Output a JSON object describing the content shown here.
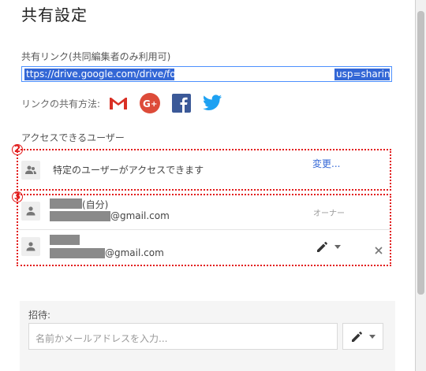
{
  "dialog": {
    "title": "共有設定",
    "link_section": {
      "label": "共有リンク(共同編集者のみ利用可)",
      "url_start": "ttps://drive.google.com/drive/folde",
      "url_end": "usp=sharing"
    },
    "share_methods": {
      "label": "リンクの共有方法:",
      "icons": [
        "gmail-icon",
        "google-plus-icon",
        "facebook-icon",
        "twitter-icon"
      ]
    },
    "access_section": {
      "label": "アクセスできるユーザー",
      "marker_2": "2",
      "marker_3": "3",
      "restricted_text": "特定のユーザーがアクセスできます",
      "change_link": "変更...",
      "users": [
        {
          "name_suffix": "(自分)",
          "email_domain": "@gmail.com",
          "role": "オーナー"
        },
        {
          "name_suffix": "",
          "email_domain": "@gmail.com",
          "role_icon": "pencil-icon"
        }
      ]
    },
    "invite": {
      "label": "招待:",
      "placeholder": "名前かメールアドレスを入力..."
    }
  },
  "colors": {
    "accent_blue": "#3367d6",
    "highlight_red": "#e21b1b"
  }
}
